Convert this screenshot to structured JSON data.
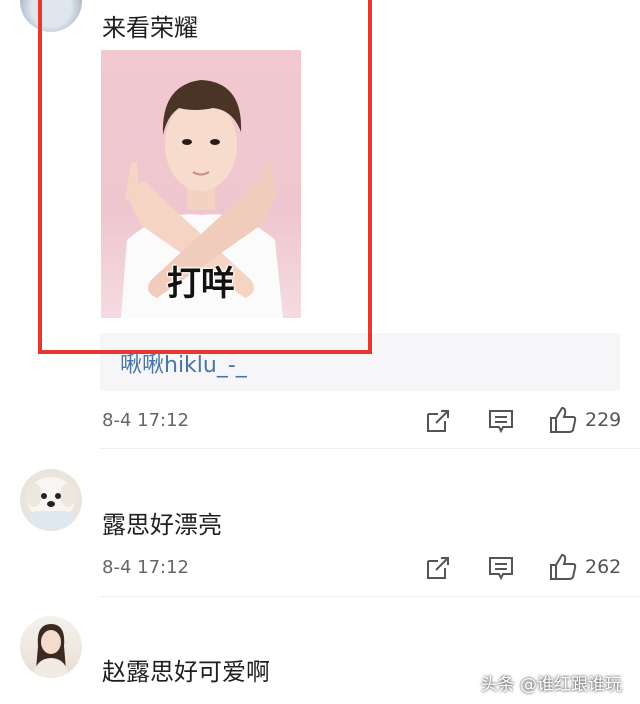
{
  "comments": [
    {
      "text": "来看荣耀",
      "sticker_caption": "打咩",
      "reply_user": "啾啾hiklu_-_",
      "time": "8-4 17:12",
      "likes": "229"
    },
    {
      "text": "露思好漂亮",
      "time": "8-4 17:12",
      "likes": "262"
    },
    {
      "text": "赵露思好可爱啊"
    }
  ],
  "icons": {
    "share": "share-icon",
    "comment": "comment-icon",
    "like": "thumbs-up-icon"
  },
  "colors": {
    "highlight": "#e8372b",
    "link": "#4a74a8"
  },
  "watermark": "头条 @谁红跟谁玩"
}
